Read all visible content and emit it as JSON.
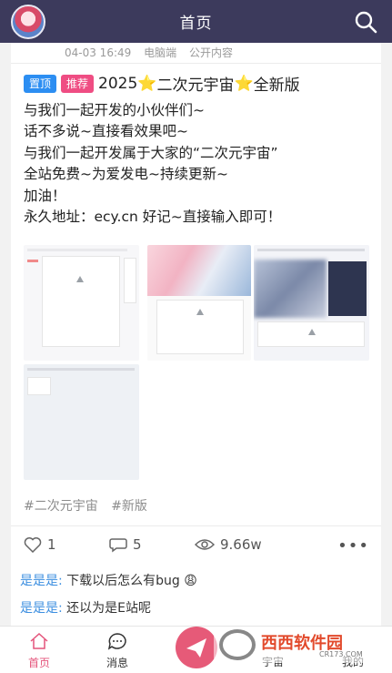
{
  "header": {
    "title": "首页"
  },
  "post": {
    "meta": {
      "time": "04-03 16:49",
      "device": "电脑端",
      "visibility": "公开内容"
    },
    "tags": {
      "top": "置顶",
      "recommend": "推荐"
    },
    "title": {
      "year": "2025",
      "star": "⭐",
      "name": "二次元宇宙",
      "suffix": "全新版"
    },
    "body": [
      "与我们一起开发的小伙伴们~",
      "话不多说~直接看效果吧~",
      "与我们一起开发属于大家的“二次元宇宙”",
      "全站免费~为爱发电~持续更新~",
      "加油！",
      "永久地址：ecy.cn 好记~直接输入即可！"
    ],
    "hashtags": [
      "#二次元宇宙",
      "#新版"
    ],
    "stats": {
      "likes": "1",
      "comments": "5",
      "views": "9.66w",
      "more": "•••"
    },
    "comments": [
      {
        "user": "是是是:",
        "text": "下载以后怎么有bug",
        "emoji": "😩"
      },
      {
        "user": "是是是:",
        "text": "还以为是E站呢"
      }
    ]
  },
  "nav": {
    "home": "首页",
    "messages": "消息",
    "universe": "宇宙",
    "me": "我的"
  },
  "watermark": {
    "text": "西西软件园",
    "sub": "CR173.COM"
  },
  "colors": {
    "header_bg": "#3c3a5c",
    "accent_pink": "#e4547b",
    "tag_blue": "#2c8ef2",
    "tag_pink": "#ef4d83",
    "link_blue": "#3d8fe0"
  }
}
